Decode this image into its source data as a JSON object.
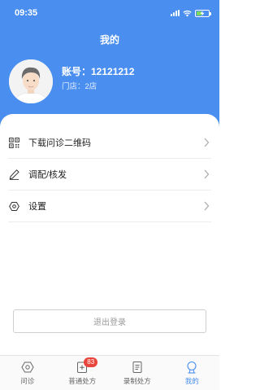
{
  "status_bar": {
    "time": "09:35"
  },
  "header": {
    "title": "我的"
  },
  "profile": {
    "account": "账号：12121212",
    "store": "门店：2店"
  },
  "menu": {
    "items": [
      {
        "label": "下载问诊二维码",
        "icon": "qr-code-icon"
      },
      {
        "label": "调配/核发",
        "icon": "pen-icon"
      },
      {
        "label": "设置",
        "icon": "settings-icon"
      }
    ]
  },
  "logout": {
    "label": "退出登录"
  },
  "tabbar": {
    "tabs": [
      {
        "label": "问诊",
        "icon": "consult-icon"
      },
      {
        "label": "普通处方",
        "icon": "prescription-icon",
        "badge": "83"
      },
      {
        "label": "录制处方",
        "icon": "record-icon"
      },
      {
        "label": "我的",
        "icon": "profile-icon",
        "active": true
      }
    ]
  },
  "colors": {
    "primary": "#4a8ff0",
    "badge": "#e8463c"
  }
}
